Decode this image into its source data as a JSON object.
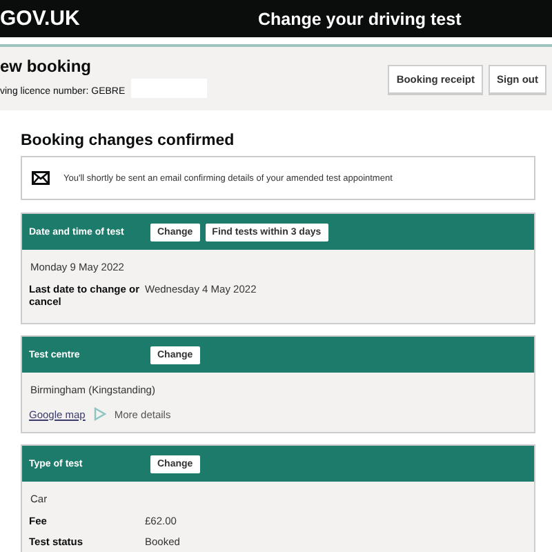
{
  "header": {
    "logo": "GOV.UK",
    "title": "Change your driving test"
  },
  "account": {
    "heading": "ew booking",
    "licence": "ving licence number: GEBRE",
    "buttons": [
      "Booking receipt",
      "Sign out"
    ]
  },
  "confirmation": {
    "heading": "Booking changes confirmed",
    "message": "You'll shortly be sent an email confirming details of your amended test appointment"
  },
  "sections": [
    {
      "title": "Date and time of test",
      "buttons": [
        "Change",
        "Find tests within 3 days"
      ],
      "rows": [
        {
          "kind": "value",
          "value": "Monday 9 May 2022"
        },
        {
          "kind": "pair",
          "label": "Last date to change or cancel",
          "value": "Wednesday 4 May 2022"
        }
      ]
    },
    {
      "title": "Test centre",
      "buttons": [
        "Change"
      ],
      "rows": [
        {
          "kind": "value",
          "value": "Birmingham (Kingstanding)"
        },
        {
          "kind": "links",
          "link": "Google map",
          "detail": "More details"
        }
      ]
    },
    {
      "title": "Type of test",
      "buttons": [
        "Change"
      ],
      "rows": [
        {
          "kind": "value",
          "value": "Car"
        },
        {
          "kind": "pair",
          "label": "Fee",
          "value": "£62.00"
        },
        {
          "kind": "pair",
          "label": "Test status",
          "value": "Booked"
        }
      ]
    }
  ]
}
